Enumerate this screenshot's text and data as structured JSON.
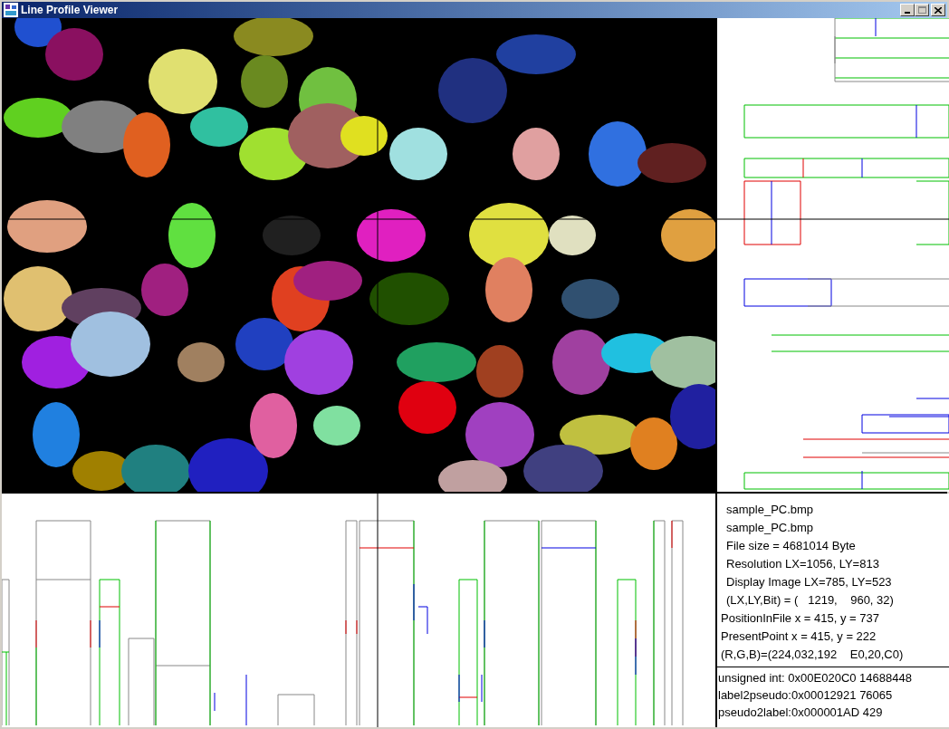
{
  "window": {
    "title": "Line Profile Viewer"
  },
  "info": {
    "lines": [
      {
        "kind": "file",
        "text": "sample_PC.bmp"
      },
      {
        "kind": "file",
        "text": "sample_PC.bmp"
      },
      {
        "kind": "file",
        "text": "File size = 4681014 Byte"
      },
      {
        "kind": "file",
        "text": "Resolution LX=1056, LY=813"
      },
      {
        "kind": "file",
        "text": "Display Image LX=785, LY=523"
      },
      {
        "kind": "file",
        "text": "(LX,LY,Bit) = (   1219,    960, 32)"
      },
      {
        "kind": "point",
        "text": "PositionInFile x = 415, y = 737"
      },
      {
        "kind": "point",
        "text": "PresentPoint x = 415, y = 222"
      },
      {
        "kind": "point",
        "text": "(R,G,B)=(224,032,192    E0,20,C0)"
      }
    ],
    "values": [
      "unsigned int: 0x00E020C0 14688448",
      "label2pseudo:0x00012921 76065",
      "pseudo2label:0x000001AD 429"
    ]
  }
}
